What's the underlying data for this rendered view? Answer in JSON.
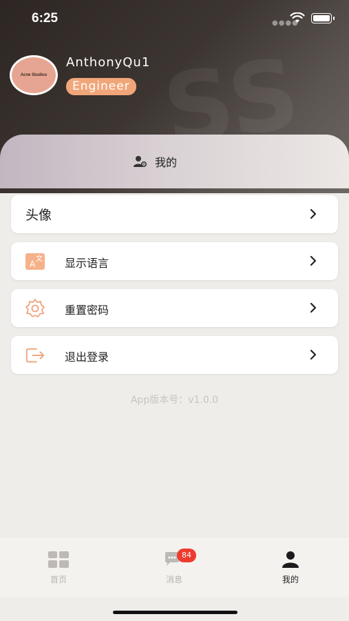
{
  "status_bar": {
    "time": "6:25"
  },
  "profile": {
    "avatar_text": "Acne Studios",
    "username": "AnthonyQu1",
    "role": "Engineer"
  },
  "section": {
    "title": "我的"
  },
  "menu": [
    {
      "label": "头像",
      "icon": "none"
    },
    {
      "label": "显示语言",
      "icon": "translate-icon"
    },
    {
      "label": "重置密码",
      "icon": "gear-icon"
    },
    {
      "label": "退出登录",
      "icon": "logout-icon"
    }
  ],
  "version": "App版本号：v1.0.0",
  "tabs": [
    {
      "label": "首页",
      "icon": "grid-icon"
    },
    {
      "label": "消息",
      "icon": "chat-icon",
      "badge": "84"
    },
    {
      "label": "我的",
      "icon": "person-icon",
      "active": true
    }
  ],
  "colors": {
    "accent": "#f1a67a",
    "badge": "#ee3b2e",
    "header_dark": "#2d2623"
  }
}
